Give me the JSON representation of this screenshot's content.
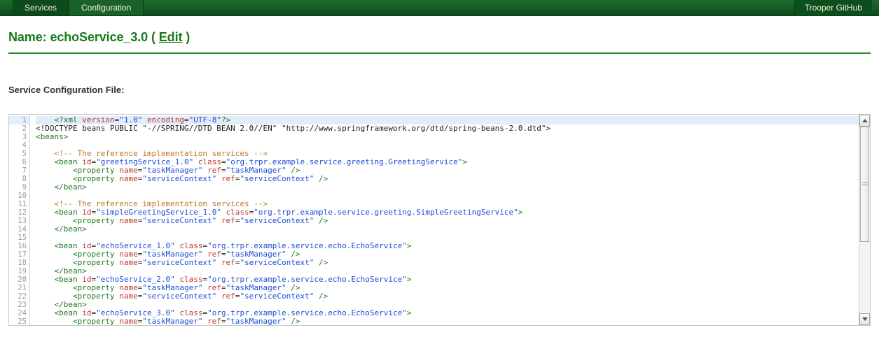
{
  "navbar": {
    "left_tabs": [
      {
        "label": "Services",
        "active": false
      },
      {
        "label": "Configuration",
        "active": true
      }
    ],
    "right_tabs": [
      {
        "label": "Trooper GitHub"
      }
    ],
    "background_color": "#0d4a1d",
    "text_color": "#f2f0c8"
  },
  "title": {
    "prefix": "Name:",
    "service_name": "echoService_3.0",
    "paren_open": "(",
    "edit_label": "Edit",
    "paren_close": ")",
    "accent_color": "#1a7a1a"
  },
  "section": {
    "heading": "Service Configuration File:"
  },
  "editor": {
    "highlighted_line": 1,
    "highlight_color": "#e3ecfb",
    "first_visible_line": 1,
    "last_visible_line": 25,
    "scrollbar": {
      "up_arrow": "scroll-up-arrow",
      "down_arrow": "scroll-down-arrow",
      "thumb_position_percent": 0,
      "thumb_size_percent": 62
    },
    "syntax_colors": {
      "tag": "#1f7a1f",
      "attribute": "#c0392b",
      "value": "#1f4fd8",
      "comment": "#c07828",
      "text": "#222222"
    },
    "lines": [
      {
        "n": 1,
        "highlight": true,
        "tokens": [
          {
            "t": "punct",
            "s": "    "
          },
          {
            "t": "tag",
            "s": "<?xml "
          },
          {
            "t": "attr",
            "s": "version"
          },
          {
            "t": "punct",
            "s": "="
          },
          {
            "t": "val",
            "s": "\"1.0\""
          },
          {
            "t": "punct",
            "s": " "
          },
          {
            "t": "attr",
            "s": "encoding"
          },
          {
            "t": "punct",
            "s": "="
          },
          {
            "t": "val",
            "s": "\"UTF-8\""
          },
          {
            "t": "tag",
            "s": "?>"
          }
        ]
      },
      {
        "n": 2,
        "tokens": [
          {
            "t": "doc",
            "s": "<!DOCTYPE beans PUBLIC \"-//SPRING//DTD BEAN 2.0//EN\" \"http://www.springframework.org/dtd/spring-beans-2.0.dtd\">"
          }
        ]
      },
      {
        "n": 3,
        "tokens": [
          {
            "t": "tag",
            "s": "<beans>"
          }
        ]
      },
      {
        "n": 4,
        "tokens": []
      },
      {
        "n": 5,
        "tokens": [
          {
            "t": "punct",
            "s": "    "
          },
          {
            "t": "com",
            "s": "<!-- The reference implementation services -->"
          }
        ]
      },
      {
        "n": 6,
        "tokens": [
          {
            "t": "punct",
            "s": "    "
          },
          {
            "t": "tag",
            "s": "<bean "
          },
          {
            "t": "attr",
            "s": "id"
          },
          {
            "t": "punct",
            "s": "="
          },
          {
            "t": "val",
            "s": "\"greetingService_1.0\""
          },
          {
            "t": "punct",
            "s": " "
          },
          {
            "t": "attr",
            "s": "class"
          },
          {
            "t": "punct",
            "s": "="
          },
          {
            "t": "val",
            "s": "\"org.trpr.example.service.greeting.GreetingService\""
          },
          {
            "t": "tag",
            "s": ">"
          }
        ]
      },
      {
        "n": 7,
        "tokens": [
          {
            "t": "punct",
            "s": "        "
          },
          {
            "t": "tag",
            "s": "<property "
          },
          {
            "t": "attr",
            "s": "name"
          },
          {
            "t": "punct",
            "s": "="
          },
          {
            "t": "val",
            "s": "\"taskManager\""
          },
          {
            "t": "punct",
            "s": " "
          },
          {
            "t": "attr",
            "s": "ref"
          },
          {
            "t": "punct",
            "s": "="
          },
          {
            "t": "val",
            "s": "\"taskManager\""
          },
          {
            "t": "tag",
            "s": " />"
          }
        ]
      },
      {
        "n": 8,
        "tokens": [
          {
            "t": "punct",
            "s": "        "
          },
          {
            "t": "tag",
            "s": "<property "
          },
          {
            "t": "attr",
            "s": "name"
          },
          {
            "t": "punct",
            "s": "="
          },
          {
            "t": "val",
            "s": "\"serviceContext\""
          },
          {
            "t": "punct",
            "s": " "
          },
          {
            "t": "attr",
            "s": "ref"
          },
          {
            "t": "punct",
            "s": "="
          },
          {
            "t": "val",
            "s": "\"serviceContext\""
          },
          {
            "t": "tag",
            "s": " />"
          }
        ]
      },
      {
        "n": 9,
        "tokens": [
          {
            "t": "punct",
            "s": "    "
          },
          {
            "t": "tag",
            "s": "</bean>"
          }
        ]
      },
      {
        "n": 10,
        "tokens": []
      },
      {
        "n": 11,
        "tokens": [
          {
            "t": "punct",
            "s": "    "
          },
          {
            "t": "com",
            "s": "<!-- The reference implementation services -->"
          }
        ]
      },
      {
        "n": 12,
        "tokens": [
          {
            "t": "punct",
            "s": "    "
          },
          {
            "t": "tag",
            "s": "<bean "
          },
          {
            "t": "attr",
            "s": "id"
          },
          {
            "t": "punct",
            "s": "="
          },
          {
            "t": "val",
            "s": "\"simpleGreetingService_1.0\""
          },
          {
            "t": "punct",
            "s": " "
          },
          {
            "t": "attr",
            "s": "class"
          },
          {
            "t": "punct",
            "s": "="
          },
          {
            "t": "val",
            "s": "\"org.trpr.example.service.greeting.SimpleGreetingService\""
          },
          {
            "t": "tag",
            "s": ">"
          }
        ]
      },
      {
        "n": 13,
        "tokens": [
          {
            "t": "punct",
            "s": "        "
          },
          {
            "t": "tag",
            "s": "<property "
          },
          {
            "t": "attr",
            "s": "name"
          },
          {
            "t": "punct",
            "s": "="
          },
          {
            "t": "val",
            "s": "\"serviceContext\""
          },
          {
            "t": "punct",
            "s": " "
          },
          {
            "t": "attr",
            "s": "ref"
          },
          {
            "t": "punct",
            "s": "="
          },
          {
            "t": "val",
            "s": "\"serviceContext\""
          },
          {
            "t": "tag",
            "s": " />"
          }
        ]
      },
      {
        "n": 14,
        "tokens": [
          {
            "t": "punct",
            "s": "    "
          },
          {
            "t": "tag",
            "s": "</bean>"
          }
        ]
      },
      {
        "n": 15,
        "tokens": []
      },
      {
        "n": 16,
        "tokens": [
          {
            "t": "punct",
            "s": "    "
          },
          {
            "t": "tag",
            "s": "<bean "
          },
          {
            "t": "attr",
            "s": "id"
          },
          {
            "t": "punct",
            "s": "="
          },
          {
            "t": "val",
            "s": "\"echoService_1.0\""
          },
          {
            "t": "punct",
            "s": " "
          },
          {
            "t": "attr",
            "s": "class"
          },
          {
            "t": "punct",
            "s": "="
          },
          {
            "t": "val",
            "s": "\"org.trpr.example.service.echo.EchoService\""
          },
          {
            "t": "tag",
            "s": ">"
          }
        ]
      },
      {
        "n": 17,
        "tokens": [
          {
            "t": "punct",
            "s": "        "
          },
          {
            "t": "tag",
            "s": "<property "
          },
          {
            "t": "attr",
            "s": "name"
          },
          {
            "t": "punct",
            "s": "="
          },
          {
            "t": "val",
            "s": "\"taskManager\""
          },
          {
            "t": "punct",
            "s": " "
          },
          {
            "t": "attr",
            "s": "ref"
          },
          {
            "t": "punct",
            "s": "="
          },
          {
            "t": "val",
            "s": "\"taskManager\""
          },
          {
            "t": "tag",
            "s": " />"
          }
        ]
      },
      {
        "n": 18,
        "tokens": [
          {
            "t": "punct",
            "s": "        "
          },
          {
            "t": "tag",
            "s": "<property "
          },
          {
            "t": "attr",
            "s": "name"
          },
          {
            "t": "punct",
            "s": "="
          },
          {
            "t": "val",
            "s": "\"serviceContext\""
          },
          {
            "t": "punct",
            "s": " "
          },
          {
            "t": "attr",
            "s": "ref"
          },
          {
            "t": "punct",
            "s": "="
          },
          {
            "t": "val",
            "s": "\"serviceContext\""
          },
          {
            "t": "tag",
            "s": " />"
          }
        ]
      },
      {
        "n": 19,
        "tokens": [
          {
            "t": "punct",
            "s": "    "
          },
          {
            "t": "tag",
            "s": "</bean>"
          }
        ]
      },
      {
        "n": 20,
        "tokens": [
          {
            "t": "punct",
            "s": "    "
          },
          {
            "t": "tag",
            "s": "<bean "
          },
          {
            "t": "attr",
            "s": "id"
          },
          {
            "t": "punct",
            "s": "="
          },
          {
            "t": "val",
            "s": "\"echoService_2.0\""
          },
          {
            "t": "punct",
            "s": " "
          },
          {
            "t": "attr",
            "s": "class"
          },
          {
            "t": "punct",
            "s": "="
          },
          {
            "t": "val",
            "s": "\"org.trpr.example.service.echo.EchoService\""
          },
          {
            "t": "tag",
            "s": ">"
          }
        ]
      },
      {
        "n": 21,
        "tokens": [
          {
            "t": "punct",
            "s": "        "
          },
          {
            "t": "tag",
            "s": "<property "
          },
          {
            "t": "attr",
            "s": "name"
          },
          {
            "t": "punct",
            "s": "="
          },
          {
            "t": "val",
            "s": "\"taskManager\""
          },
          {
            "t": "punct",
            "s": " "
          },
          {
            "t": "attr",
            "s": "ref"
          },
          {
            "t": "punct",
            "s": "="
          },
          {
            "t": "val",
            "s": "\"taskManager\""
          },
          {
            "t": "tag",
            "s": " />"
          }
        ]
      },
      {
        "n": 22,
        "tokens": [
          {
            "t": "punct",
            "s": "        "
          },
          {
            "t": "tag",
            "s": "<property "
          },
          {
            "t": "attr",
            "s": "name"
          },
          {
            "t": "punct",
            "s": "="
          },
          {
            "t": "val",
            "s": "\"serviceContext\""
          },
          {
            "t": "punct",
            "s": " "
          },
          {
            "t": "attr",
            "s": "ref"
          },
          {
            "t": "punct",
            "s": "="
          },
          {
            "t": "val",
            "s": "\"serviceContext\""
          },
          {
            "t": "tag",
            "s": " />"
          }
        ]
      },
      {
        "n": 23,
        "tokens": [
          {
            "t": "punct",
            "s": "    "
          },
          {
            "t": "tag",
            "s": "</bean>"
          }
        ]
      },
      {
        "n": 24,
        "tokens": [
          {
            "t": "punct",
            "s": "    "
          },
          {
            "t": "tag",
            "s": "<bean "
          },
          {
            "t": "attr",
            "s": "id"
          },
          {
            "t": "punct",
            "s": "="
          },
          {
            "t": "val",
            "s": "\"echoService_3.0\""
          },
          {
            "t": "punct",
            "s": " "
          },
          {
            "t": "attr",
            "s": "class"
          },
          {
            "t": "punct",
            "s": "="
          },
          {
            "t": "val",
            "s": "\"org.trpr.example.service.echo.EchoService\""
          },
          {
            "t": "tag",
            "s": ">"
          }
        ]
      },
      {
        "n": 25,
        "tokens": [
          {
            "t": "punct",
            "s": "        "
          },
          {
            "t": "tag",
            "s": "<property "
          },
          {
            "t": "attr",
            "s": "name"
          },
          {
            "t": "punct",
            "s": "="
          },
          {
            "t": "val",
            "s": "\"taskManager\""
          },
          {
            "t": "punct",
            "s": " "
          },
          {
            "t": "attr",
            "s": "ref"
          },
          {
            "t": "punct",
            "s": "="
          },
          {
            "t": "val",
            "s": "\"taskManager\""
          },
          {
            "t": "tag",
            "s": " />"
          }
        ]
      }
    ]
  }
}
